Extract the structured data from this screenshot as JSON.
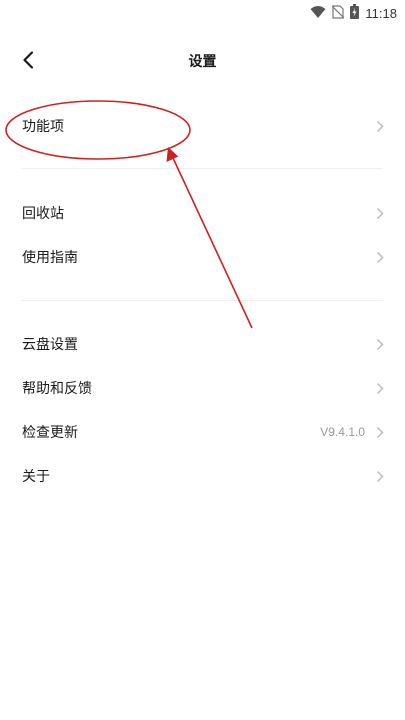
{
  "status_bar": {
    "time": "11:18",
    "icons": [
      "wifi-icon",
      "no-sim-icon",
      "battery-icon"
    ]
  },
  "header": {
    "title": "设置",
    "back_icon": "chevron-left-icon"
  },
  "menu": {
    "group1": [
      {
        "label": "功能项"
      }
    ],
    "group2": [
      {
        "label": "回收站"
      },
      {
        "label": "使用指南"
      }
    ],
    "group3": [
      {
        "label": "云盘设置"
      },
      {
        "label": "帮助和反馈"
      },
      {
        "label": "检查更新",
        "value": "V9.4.1.0"
      },
      {
        "label": "关于"
      }
    ]
  },
  "colors": {
    "annotation": "#d22020",
    "chevron": "#bbbbbb"
  }
}
